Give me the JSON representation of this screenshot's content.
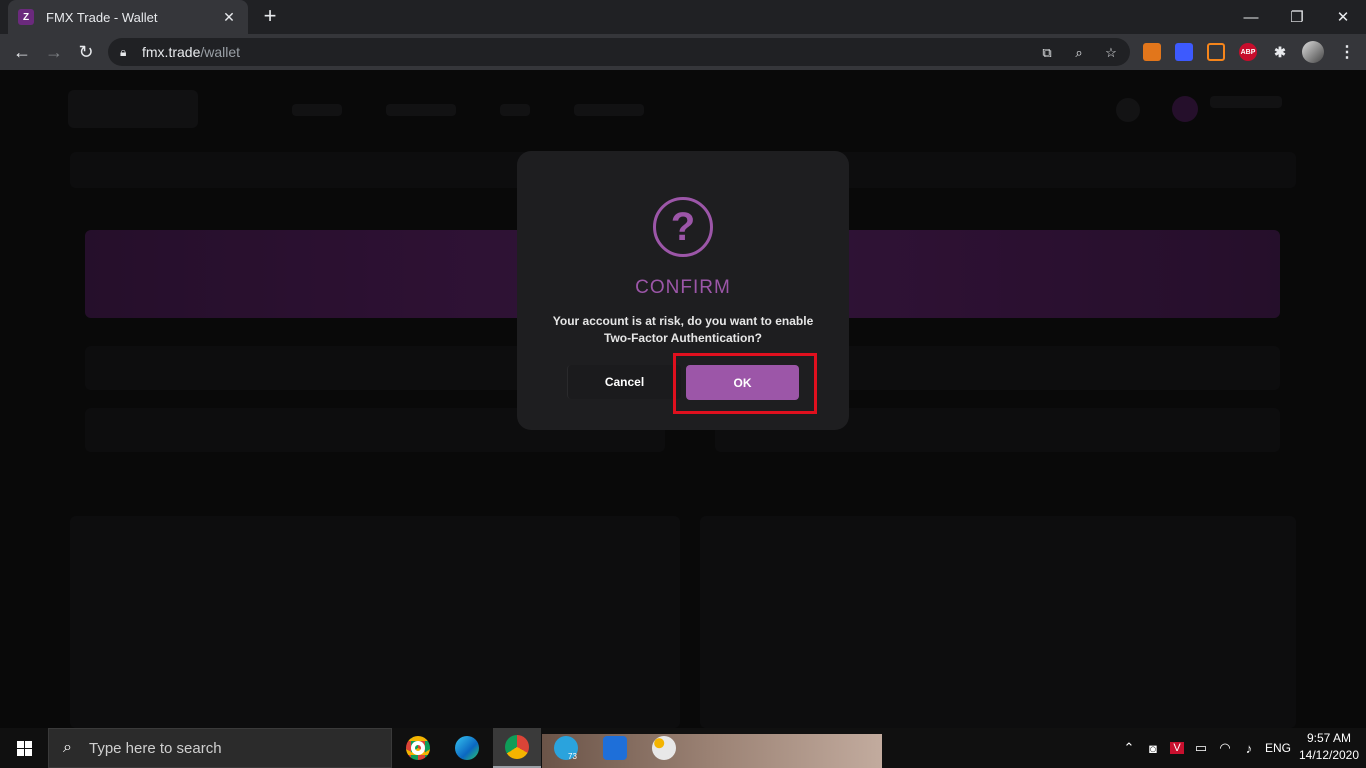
{
  "browser": {
    "tab_title": "FMX Trade - Wallet",
    "url_host": "fmx.trade",
    "url_path": "/wallet",
    "ext_labels": {
      "abp": "ABP"
    }
  },
  "dialog": {
    "title": "CONFIRM",
    "message_line1": "Your account is at risk, do you want to enable",
    "message_line2": "Two-Factor Authentication?",
    "cancel_label": "Cancel",
    "ok_label": "OK",
    "accent_color": "#9c56a8",
    "highlight_color": "#e0101e"
  },
  "taskbar": {
    "search_placeholder": "Type here to search",
    "telegram_badge": "73",
    "language": "ENG",
    "time": "9:57 AM",
    "date": "14/12/2020"
  }
}
